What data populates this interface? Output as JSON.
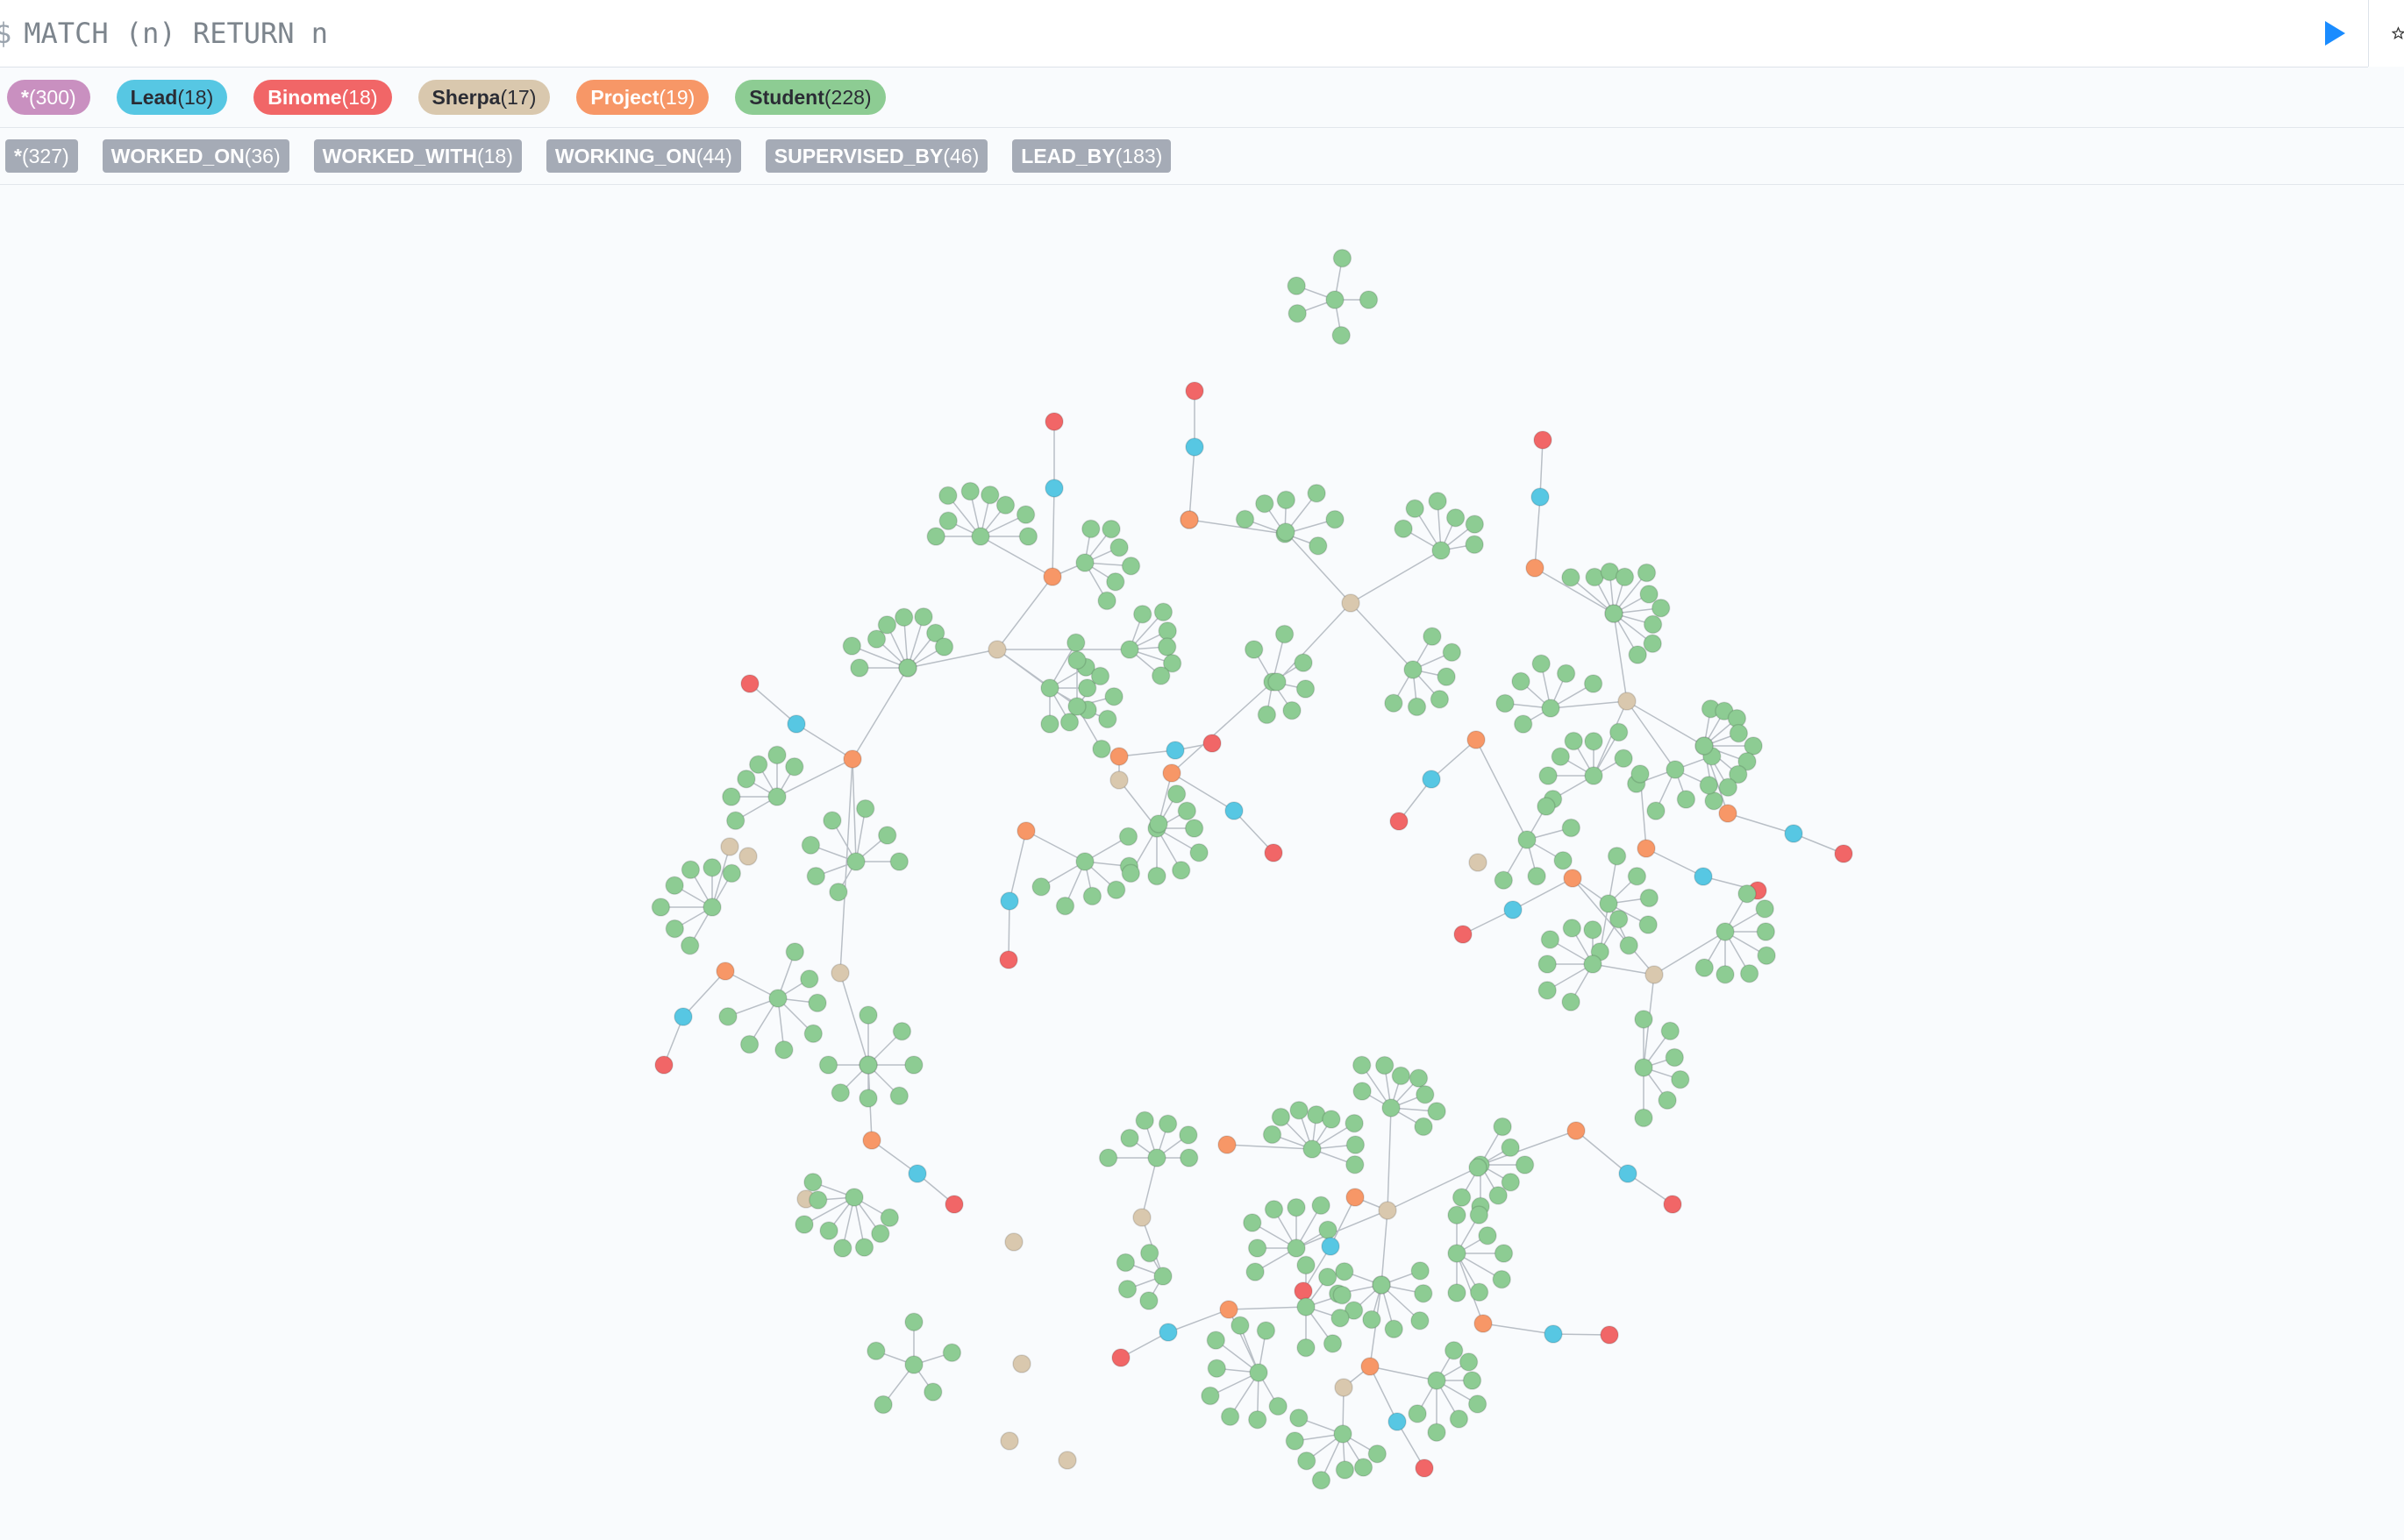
{
  "query": {
    "prompt": "$",
    "text": "MATCH (n) RETURN n"
  },
  "node_labels": [
    {
      "name": "*",
      "count": "(300)",
      "bg": "#c990c0",
      "fg": "#ffffff"
    },
    {
      "name": "Lead",
      "count": "(18)",
      "bg": "#57c7e3",
      "fg": "#2a2c34"
    },
    {
      "name": "Binome",
      "count": "(18)",
      "bg": "#f16667",
      "fg": "#ffffff"
    },
    {
      "name": "Sherpa",
      "count": "(17)",
      "bg": "#d9c8ae",
      "fg": "#2a2c34"
    },
    {
      "name": "Project",
      "count": "(19)",
      "bg": "#f79767",
      "fg": "#ffffff"
    },
    {
      "name": "Student",
      "count": "(228)",
      "bg": "#8dcc93",
      "fg": "#2a2c34"
    }
  ],
  "relationship_types": [
    {
      "name": "*",
      "count": "(327)"
    },
    {
      "name": "WORKED_ON",
      "count": "(36)"
    },
    {
      "name": "WORKED_WITH",
      "count": "(18)"
    },
    {
      "name": "WORKING_ON",
      "count": "(44)"
    },
    {
      "name": "SUPERVISED_BY",
      "count": "(46)"
    },
    {
      "name": "LEAD_BY",
      "count": "(183)"
    }
  ],
  "colors": {
    "student": "#8dcc93",
    "lead": "#57c7e3",
    "binome": "#f16667",
    "sherpa": "#d9c8ae",
    "project": "#f79767",
    "edge": "#b9bfc6",
    "run": "#1a8cff"
  }
}
